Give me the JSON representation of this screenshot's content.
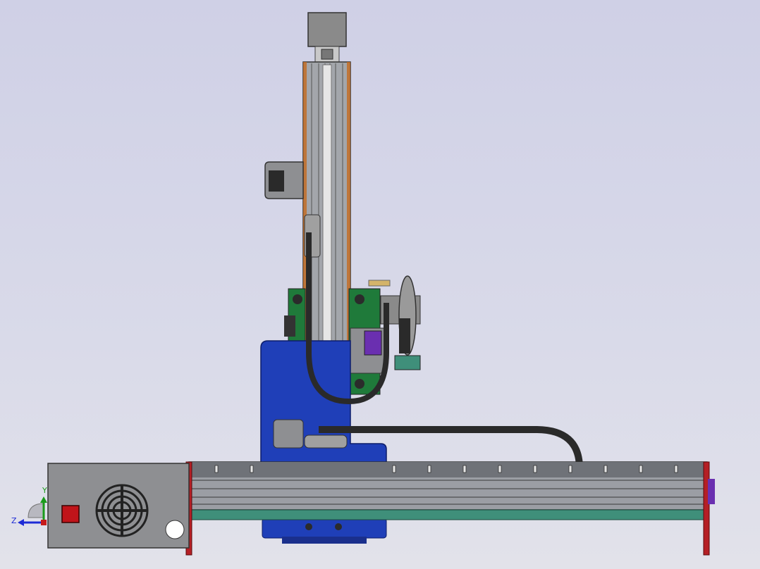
{
  "viewport": {
    "background_top": "#cfd0e6",
    "background_bottom": "#e2e2ea"
  },
  "triad": {
    "y_label": "Y",
    "z_label": "Z",
    "y_color": "#1a9b1a",
    "z_color": "#1e2bd6",
    "origin_color": "#c61b1b"
  },
  "colors": {
    "carriage_blue": "#1f3fb8",
    "rail_gray": "#9b9ea4",
    "motor_gray": "#8c8c8c",
    "pcb_green": "#1f7a3a",
    "bracket_purple": "#6a2fb0",
    "base_teal": "#3f8f7a",
    "endplate_red": "#b51f25",
    "cable_black": "#2a2a2a",
    "psu_gray": "#8e8f92",
    "button_red": "#c0141a"
  }
}
